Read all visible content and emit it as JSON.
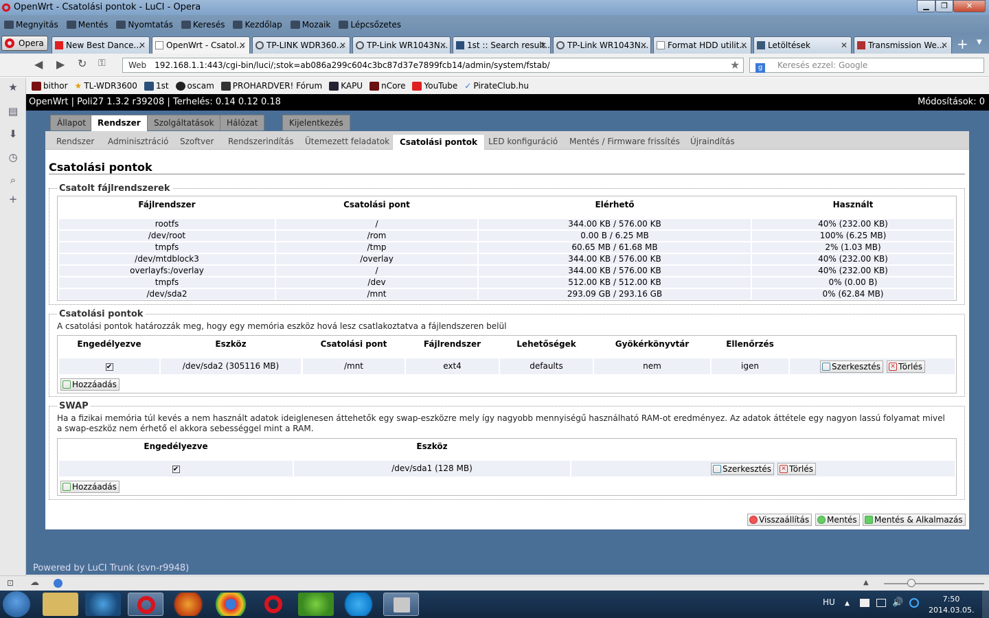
{
  "window": {
    "title": "OpenWrt - Csatolási pontok - LuCI - Opera"
  },
  "menubar": {
    "items": [
      "Megnyitás",
      "Mentés",
      "Nyomtatás",
      "Keresés",
      "Kezdőlap",
      "Mozaik",
      "Lépcsőzetes"
    ]
  },
  "browser": {
    "opera_label": "Opera",
    "tabs": [
      "New Best Dance...",
      "OpenWrt - Csatol...",
      "TP-LINK WDR360...",
      "TP-Link WR1043N...",
      "1st :: Search result...",
      "TP-Link WR1043N...",
      "Format HDD utilit...",
      "Letöltések",
      "Transmission We..."
    ],
    "web_label": "Web",
    "url": "192.168.1.1:443/cgi-bin/luci/;stok=ab086a299c604c3bc87d37e7899fcb14/admin/system/fstab/",
    "search_placeholder": "Keresés ezzel: Google",
    "bookmarks": [
      "bithor",
      "TL-WDR3600",
      "1st",
      "oscam",
      "PROHARDVER! Fórum",
      "KAPU",
      "nCore",
      "YouTube",
      "PirateClub.hu"
    ]
  },
  "header": {
    "left": "OpenWrt | Poli27 1.3.2 r39208 | Terhelés: 0.14 0.12 0.18",
    "right": "Módosítások: 0"
  },
  "main_tabs": [
    "Állapot",
    "Rendszer",
    "Szolgáltatások",
    "Hálózat",
    "Kijelentkezés"
  ],
  "sub_tabs": [
    "Rendszer",
    "Adminisztráció",
    "Szoftver",
    "Rendszerindítás",
    "Ütemezett feladatok",
    "Csatolási pontok",
    "LED konfiguráció",
    "Mentés / Firmware frissítés",
    "Újraindítás"
  ],
  "page": {
    "title": "Csatolási pontok"
  },
  "mounted": {
    "legend": "Csatolt fájlrendszerek",
    "headers": [
      "Fájlrendszer",
      "Csatolási pont",
      "Elérhető",
      "Használt"
    ],
    "rows": [
      [
        "rootfs",
        "/",
        "344.00 KB / 576.00 KB",
        "40% (232.00 KB)"
      ],
      [
        "/dev/root",
        "/rom",
        "0.00 B / 6.25 MB",
        "100% (6.25 MB)"
      ],
      [
        "tmpfs",
        "/tmp",
        "60.65 MB / 61.68 MB",
        "2% (1.03 MB)"
      ],
      [
        "/dev/mtdblock3",
        "/overlay",
        "344.00 KB / 576.00 KB",
        "40% (232.00 KB)"
      ],
      [
        "overlayfs:/overlay",
        "/",
        "344.00 KB / 576.00 KB",
        "40% (232.00 KB)"
      ],
      [
        "tmpfs",
        "/dev",
        "512.00 KB / 512.00 KB",
        "0% (0.00 B)"
      ],
      [
        "/dev/sda2",
        "/mnt",
        "293.09 GB / 293.16 GB",
        "0% (62.84 MB)"
      ]
    ]
  },
  "mounts": {
    "legend": "Csatolási pontok",
    "description": "A csatolási pontok határozzák meg, hogy egy memória eszköz hová lesz csatlakoztatva a fájlendszeren belül",
    "headers": [
      "Engedélyezve",
      "Eszköz",
      "Csatolási pont",
      "Fájlrendszer",
      "Lehetőségek",
      "Gyökérkönyvtár",
      "Ellenőrzés"
    ],
    "row": {
      "check": "✔",
      "device": "/dev/sda2 (305116 MB)",
      "mountpoint": "/mnt",
      "fs": "ext4",
      "options": "defaults",
      "root": "nem",
      "check_fs": "igen"
    },
    "edit": "Szerkesztés",
    "delete": "Törlés",
    "add": "Hozzáadás"
  },
  "swap": {
    "legend": "SWAP",
    "description": "Ha a fizikai memória túl kevés a nem használt adatok ideiglenesen áttehetők egy swap-eszközre mely így nagyobb mennyiségű használható RAM-ot eredményez. Az adatok áttétele egy nagyon lassú folyamat mivel a swap-eszköz nem érhető el akkora sebességgel mint a RAM.",
    "headers": [
      "Engedélyezve",
      "Eszköz"
    ],
    "row": {
      "check": "✔",
      "device": "/dev/sda1 (128 MB)"
    },
    "edit": "Szerkesztés",
    "delete": "Törlés",
    "add": "Hozzáadás"
  },
  "actions": {
    "reset": "Visszaállítás",
    "save": "Mentés",
    "apply": "Mentés & Alkalmazás"
  },
  "footer": "Powered by LuCI Trunk (svn-r9948)",
  "tray": {
    "lang": "HU",
    "time": "7:50",
    "date": "2014.03.05."
  }
}
